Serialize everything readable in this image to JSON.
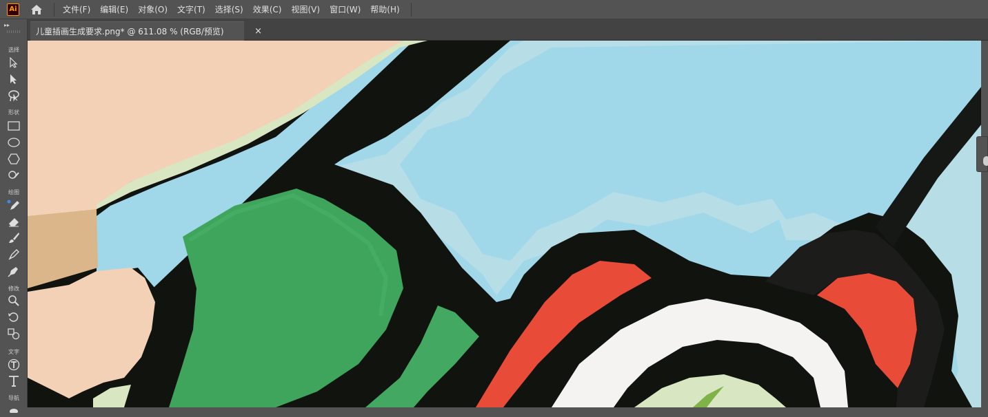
{
  "app": {
    "logo_text": "Ai"
  },
  "menu": [
    {
      "label": "文件(F)"
    },
    {
      "label": "编辑(E)"
    },
    {
      "label": "对象(O)"
    },
    {
      "label": "文字(T)"
    },
    {
      "label": "选择(S)"
    },
    {
      "label": "效果(C)"
    },
    {
      "label": "视图(V)"
    },
    {
      "label": "窗口(W)"
    },
    {
      "label": "帮助(H)"
    }
  ],
  "toolbar": {
    "collapse_label": "▸▸",
    "groups": {
      "select": "选择",
      "shape": "形状",
      "draw": "绘图",
      "modify": "修改",
      "type": "文字",
      "navigate": "导航"
    }
  },
  "document": {
    "tab_title": "儿童插画生成要求.png* @ 611.08 % (RGB/预览)",
    "close_glyph": "×"
  },
  "colors": {
    "ui_bg": "#535353",
    "sky": "#a0d8ea",
    "sky_light": "#b6dce6",
    "outline": "#10130e",
    "green": "#3fa55d",
    "skin": "#f3d1b7",
    "skin_shadow": "#dbb68b",
    "light_green": "#d8e7c1",
    "red": "#e84c38",
    "white": "#f4f3f1"
  }
}
